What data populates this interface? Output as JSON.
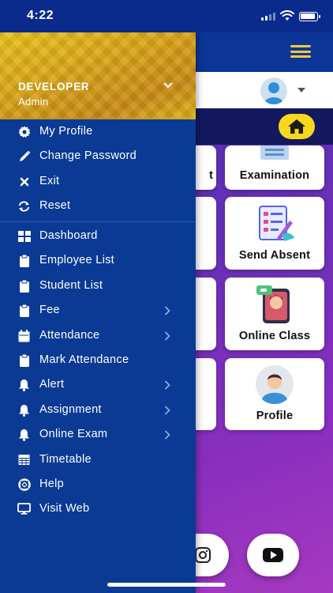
{
  "status_bar": {
    "time": "4:22"
  },
  "drawer": {
    "header": {
      "name": "DEVELOPER",
      "role": "Admin"
    },
    "account_items": [
      {
        "label": "My Profile",
        "icon": "gear-icon"
      },
      {
        "label": "Change Password",
        "icon": "pencil-icon"
      },
      {
        "label": "Exit",
        "icon": "close-icon"
      },
      {
        "label": "Reset",
        "icon": "refresh-icon"
      }
    ],
    "nav_items": [
      {
        "label": "Dashboard",
        "icon": "dashboard-icon",
        "has_submenu": false
      },
      {
        "label": "Employee List",
        "icon": "clipboard-icon",
        "has_submenu": false
      },
      {
        "label": "Student List",
        "icon": "clipboard-icon",
        "has_submenu": false
      },
      {
        "label": "Fee",
        "icon": "clipboard-icon",
        "has_submenu": true
      },
      {
        "label": "Attendance",
        "icon": "calendar-icon",
        "has_submenu": true
      },
      {
        "label": "Mark Attendance",
        "icon": "clipboard-icon",
        "has_submenu": false
      },
      {
        "label": "Alert",
        "icon": "bell-icon",
        "has_submenu": true
      },
      {
        "label": "Assignment",
        "icon": "bell-icon",
        "has_submenu": true
      },
      {
        "label": "Online Exam",
        "icon": "bell-icon",
        "has_submenu": true
      },
      {
        "label": "Timetable",
        "icon": "table-icon",
        "has_submenu": false
      },
      {
        "label": "Help",
        "icon": "lifebuoy-icon",
        "has_submenu": false
      },
      {
        "label": "Visit Web",
        "icon": "monitor-icon",
        "has_submenu": false
      }
    ]
  },
  "dashboard": {
    "cards": [
      {
        "label": "Examination"
      },
      {
        "label": "Send Absent"
      },
      {
        "label": "Online Class"
      },
      {
        "label": "Profile"
      }
    ],
    "partial_left_card_text": "t"
  },
  "colors": {
    "drawer_bg": "#0a3a94",
    "header_gold": "#d9a516",
    "app_bar": "#0b3596",
    "home_button": "#f8d81c",
    "hamburger": "#f6c83c"
  }
}
